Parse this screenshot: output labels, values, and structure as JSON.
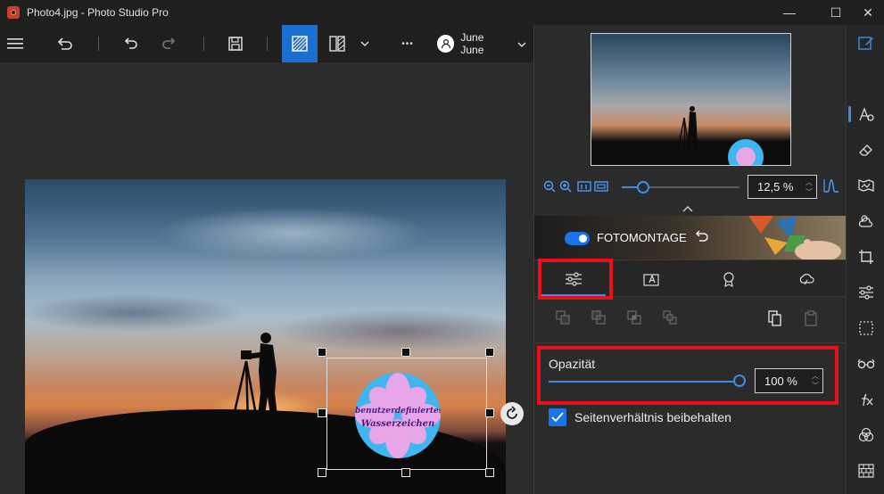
{
  "window": {
    "title": "Photo4.jpg - Photo Studio Pro",
    "minimize_glyph": "—",
    "maximize_glyph": "☐",
    "close_glyph": "✕"
  },
  "toolbar": {
    "user_name": "June June",
    "more_glyph": "•••"
  },
  "watermark": {
    "line1": "benutzerdefiniertes",
    "line2": "Wasserzeichen"
  },
  "navigator": {
    "zoom_value": "12,5 %",
    "zoom_level": 0.18
  },
  "banner": {
    "label": "FOTOMONTAGE",
    "toggle_on": true
  },
  "properties": {
    "opacity_label": "Opazität",
    "opacity_value": "100 %",
    "opacity_level": 1.0,
    "aspect_label": "Seitenverhältnis beibehalten",
    "aspect_checked": true
  },
  "colors": {
    "accent": "#1a73e8",
    "highlight": "#e8101a",
    "watermark_disc": "#3fb6f0",
    "watermark_flower": "#e7a6e8"
  }
}
